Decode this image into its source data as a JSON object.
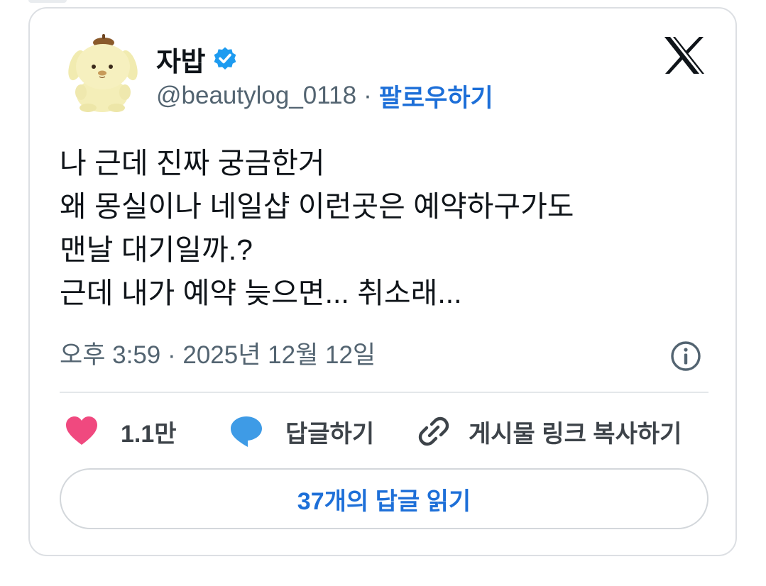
{
  "tweet": {
    "author": {
      "display_name": "자밥",
      "verified": true,
      "handle": "@beautylog_0118",
      "separator": "·",
      "follow_label": "팔로우하기",
      "avatar": "pompompurin-plush-avatar"
    },
    "platform_logo": "x-logo-icon",
    "body_lines": [
      "나 근데 진짜 궁금한거",
      "왜 몽실이나 네일샵 이런곳은 예약하구가도",
      "맨날 대기일까.?",
      "근데 내가 예약 늦으면... 취소래..."
    ],
    "timestamp": "오후 3:59 · 2025년 12월 12일",
    "actions": {
      "like_count": "1.1만",
      "reply_label": "답글하기",
      "copy_link_label": "게시물 링크 복사하기"
    },
    "read_replies_label": "37개의 답글 읽기"
  },
  "colors": {
    "accent_blue": "#1d6fd8",
    "heart_pink": "#f0497f",
    "reply_bubble_blue": "#3e9be6",
    "verified_blue": "#1d9bf0",
    "secondary_text": "#536471"
  }
}
